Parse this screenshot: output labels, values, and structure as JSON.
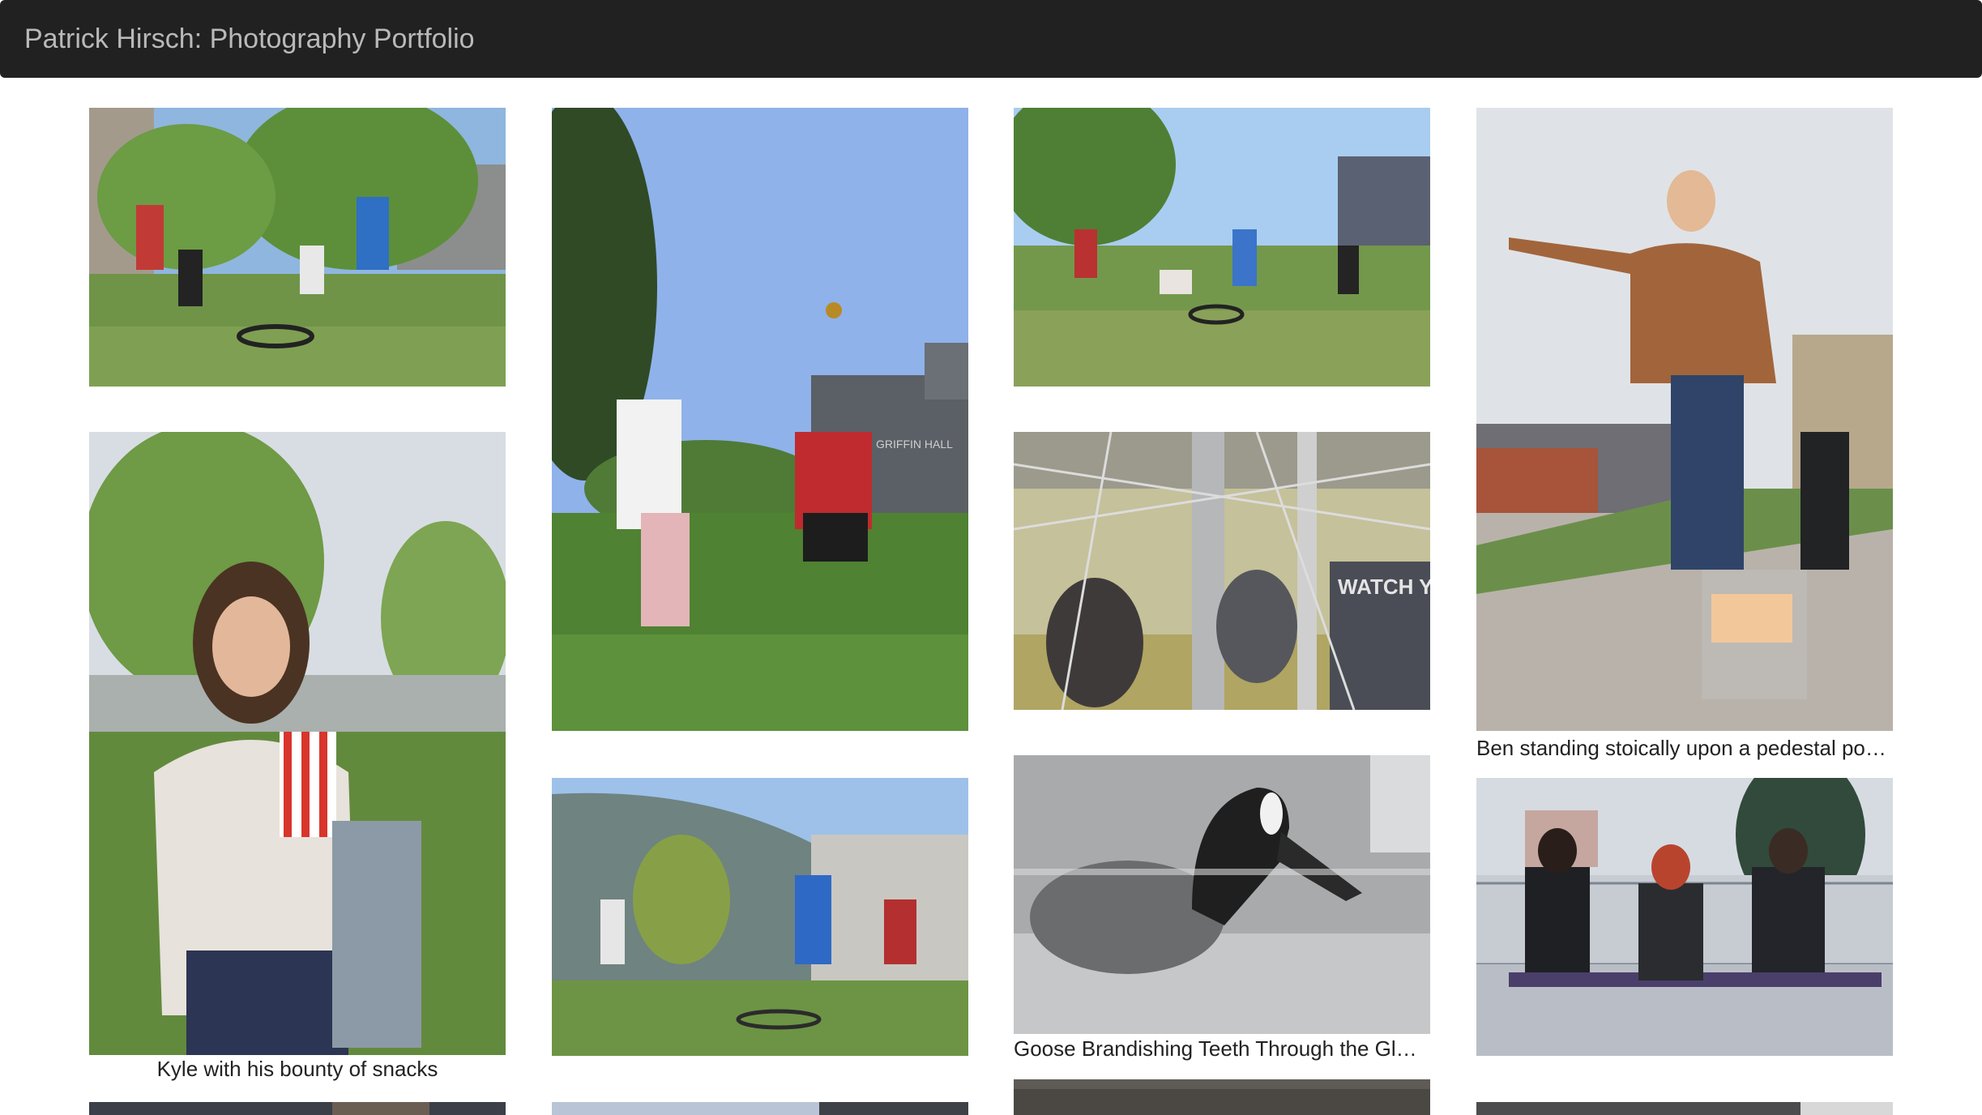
{
  "navbar": {
    "brand": "Patrick Hirsch: Photography Portfolio"
  },
  "gallery": {
    "photos": [
      {
        "subject": "spikeball game on campus lawn",
        "caption": ""
      },
      {
        "subject": "player in pink shorts leaping near Griffin Hall",
        "caption": "",
        "sign_text": "GRIFFIN HALL"
      },
      {
        "subject": "spikeball players on grass field",
        "caption": ""
      },
      {
        "subject": "Ben standing on pedestal light pointing",
        "caption": "Ben standing stoically upon a pedestal po…"
      },
      {
        "subject": "Kyle holding popcorn box and snacks",
        "caption": "Kyle with his bounty of snacks"
      },
      {
        "subject": "gym seen through netting",
        "caption": "",
        "sign_text": "WATCH YOUR STEP"
      },
      {
        "subject": "spikeball near glass building",
        "caption": ""
      },
      {
        "subject": "goose with open beak behind glass",
        "caption": "Goose Brandishing Teeth Through the Gl…"
      },
      {
        "subject": "three people lacing skates on bench",
        "caption": ""
      },
      {
        "subject": "partial photo",
        "caption": ""
      },
      {
        "subject": "partial photo",
        "caption": ""
      },
      {
        "subject": "partial photo",
        "caption": ""
      },
      {
        "subject": "partial photo",
        "caption": ""
      }
    ]
  }
}
